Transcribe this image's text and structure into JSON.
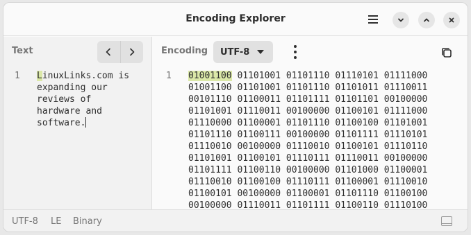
{
  "window": {
    "title": "Encoding Explorer"
  },
  "left_pane": {
    "label": "Text",
    "line_number": "1",
    "text_first_char": "L",
    "text_lines": [
      "inuxLinks.com is",
      "expanding our",
      "reviews of",
      "hardware and",
      "software."
    ]
  },
  "right_pane": {
    "label": "Encoding",
    "encoding_value": "UTF-8",
    "line_number": "1",
    "binary_first": "01001100",
    "binary_first_rest": " 01101001 01101110 01110101 01111000",
    "binary_lines": [
      "01001100 01101001 01101110 01101011 01110011",
      "00101110 01100011 01101111 01101101 00100000",
      "01101001 01110011 00100000 01100101 01111000",
      "01110000 01100001 01101110 01100100 01101001",
      "01101110 01100111 00100000 01101111 01110101",
      "01110010 00100000 01110010 01100101 01110110",
      "01101001 01100101 01110111 01110011 00100000",
      "01101111 01100110 00100000 01101000 01100001",
      "01110010 01100100 01110111 01100001 01110010",
      "01100101 00100000 01100001 01101110 01100100",
      "00100000 01110011 01101111 01100110 01110100"
    ]
  },
  "statusbar": {
    "encoding": "UTF-8",
    "endianness": "LE",
    "mode": "Binary"
  },
  "icons": {
    "menu": "hamburger-menu-icon",
    "minimize": "chevron-down-icon",
    "maximize": "chevron-up-icon",
    "close": "close-icon",
    "prev": "chevron-left-icon",
    "next": "chevron-right-icon",
    "more": "kebab-menu-icon",
    "copy": "copy-icon",
    "sidebar": "sidebar-toggle-icon"
  },
  "colors": {
    "highlight": "#dbe8a8",
    "accent_text": "#2e2e2e",
    "muted_text": "#777777"
  }
}
